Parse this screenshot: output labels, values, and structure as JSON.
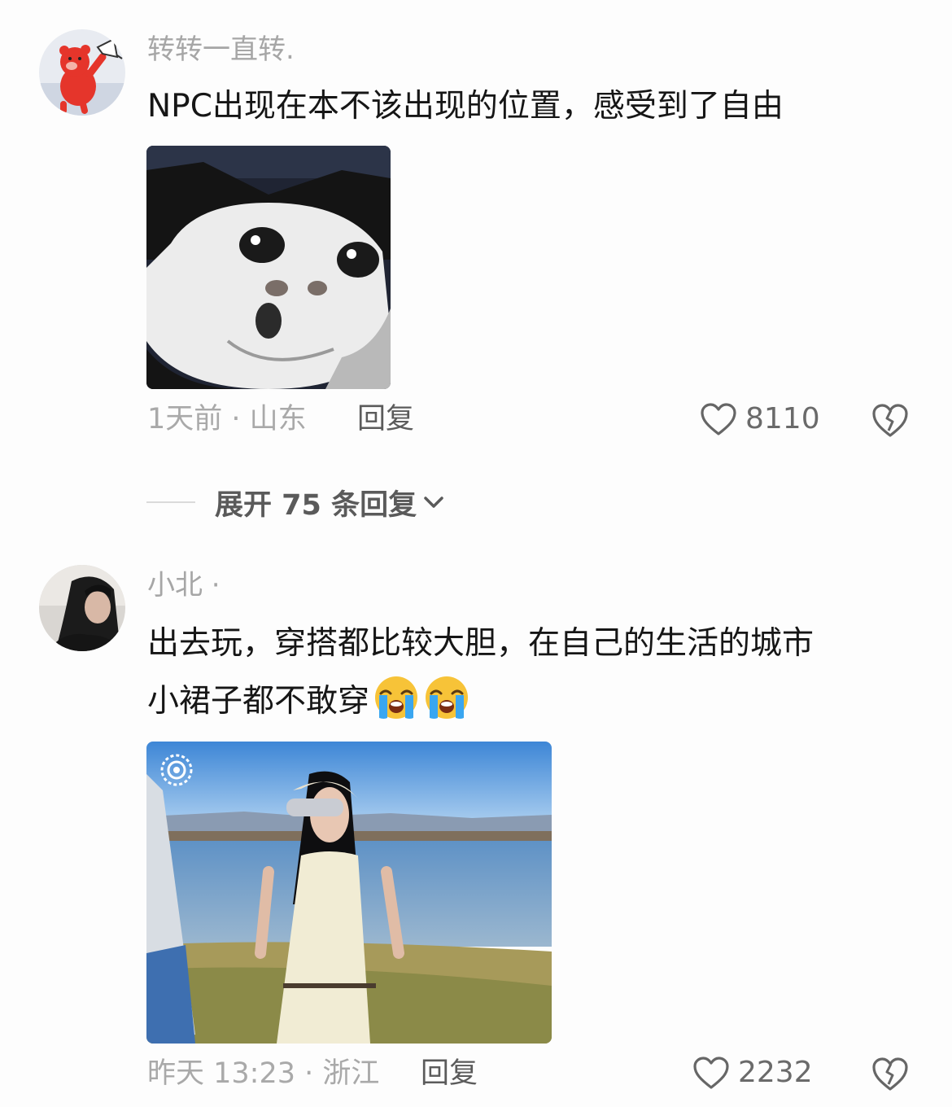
{
  "comments": [
    {
      "username": "转转一直转.",
      "text_lines": [
        "NPC出现在本不该出现的位置，感受到了自由"
      ],
      "time_location": "1天前 · 山东",
      "reply_label": "回复",
      "likes": "8110",
      "avatar_icon": "red-bear-megaphone-avatar",
      "media_desc": "crying-cat-meme-image"
    },
    {
      "username": "小北 ·",
      "text_lines": [
        "出去玩，穿搭都比较大胆，在自己的生活的城市",
        "小裙子都不敢穿"
      ],
      "emojis": [
        "loudly-crying-face-emoji",
        "loudly-crying-face-emoji"
      ],
      "time_location": "昨天 13:23 · 浙江",
      "reply_label": "回复",
      "likes": "2232",
      "avatar_icon": "user-photo-avatar",
      "media_desc": "lakeside-photo-image"
    }
  ],
  "expand_replies": {
    "label": "展开 75 条回复"
  },
  "colors": {
    "username": "#a6a6a6",
    "text": "#161616",
    "meta": "#a9a9a9",
    "reply": "#5b5b5b"
  }
}
